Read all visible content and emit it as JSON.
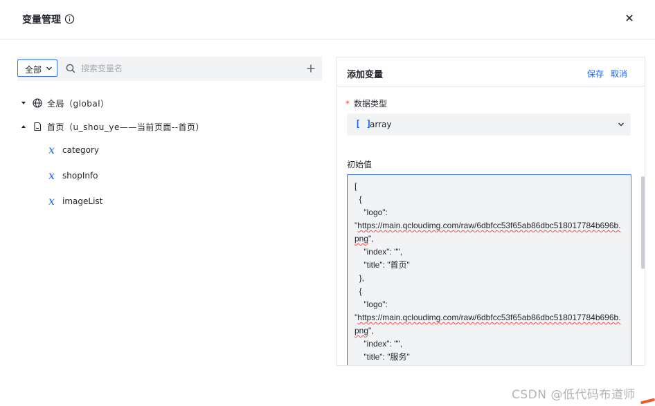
{
  "dialog": {
    "title": "变量管理",
    "info_icon": "info-circle-icon",
    "close_icon": "close-icon"
  },
  "left": {
    "scope_select": {
      "value": "全部"
    },
    "search": {
      "placeholder": "搜索变量名",
      "value": ""
    },
    "add_icon": "plus-icon",
    "tree": {
      "global": {
        "label": "全局（global）",
        "icon": "globe-icon",
        "expanded": false
      },
      "page": {
        "label": "首页（u_shou_ye——当前页面--首页）",
        "icon": "page-icon",
        "expanded": true
      },
      "variables": [
        "category",
        "shopInfo",
        "imageList"
      ]
    }
  },
  "panel": {
    "title": "添加变量",
    "save_label": "保存",
    "cancel_label": "取消",
    "type_field": {
      "label": "数据类型",
      "required_mark": "*",
      "value": "array",
      "icon_text": "[ ]"
    },
    "initial_value": {
      "label": "初始值",
      "line1": "[",
      "line2": "  {",
      "line3": "    \"logo\":",
      "url1": "https://main.qcloudimg.com/raw/6dbfcc53f65ab86dbc518017784b696b.png",
      "url1_suffix": "\",",
      "line5": "    \"index\": \"\",",
      "line6": "    \"title\": \"首页\"",
      "line7": "  },",
      "line8": "  {",
      "line9": "    \"logo\":",
      "url2": "https://main.qcloudimg.com/raw/6dbfcc53f65ab86dbc518017784b696b.png",
      "url2_suffix": "\",",
      "line11": "    \"index\": \"\",",
      "line12": "    \"title\": \"服务\""
    }
  },
  "watermark": "CSDN @低代码布道师",
  "colors": {
    "accent": "#1664ff",
    "required": "#f54a45",
    "panel_bg": "#f2f3f5"
  }
}
